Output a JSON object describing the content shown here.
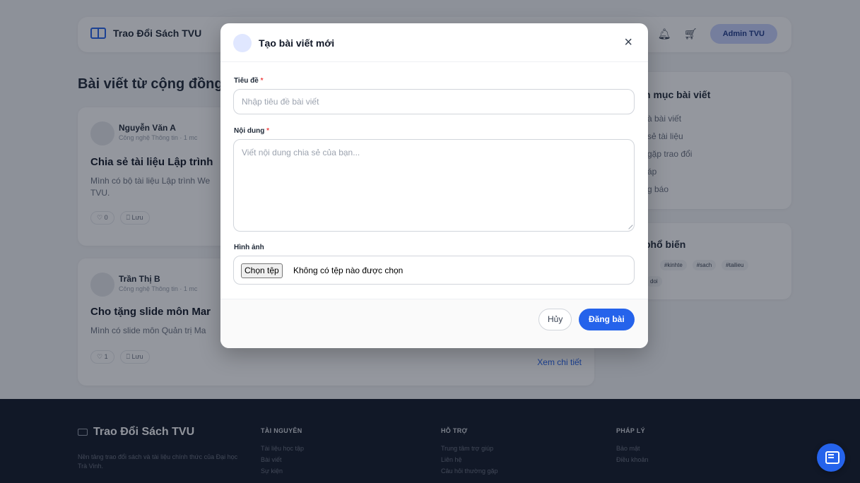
{
  "header": {
    "brand": "Trao Đổi Sách TVU",
    "admin_label": "Admin TVU"
  },
  "feed": {
    "title": "Bài viết từ cộng đồng",
    "posts": [
      {
        "author": "Nguyễn Văn A",
        "meta": "Công nghệ Thông tin · 1 mc",
        "title": "Chia sẻ tài liệu Lập trình",
        "body": "Mình có bộ tài liệu Lập trình We TVU.",
        "likes": "0",
        "save_label": "Lưu"
      },
      {
        "author": "Trần Thị B",
        "meta": "Công nghệ Thông tin · 1 mc",
        "title": "Cho tặng slide môn Mar",
        "body": "Mình có slide môn Quản trị Ma",
        "likes": "1",
        "save_label": "Lưu",
        "detail_link": "Xem chi tiết"
      }
    ]
  },
  "sidebar": {
    "categories_title": "n mục bài viết",
    "categories": [
      "à bài viết",
      "sẻ tài liệu",
      "gặp trao đổi",
      "áp",
      "g báo"
    ],
    "tags_title": "phổ biến",
    "tags": [
      "#kinhte",
      "#sach",
      "#tailieu"
    ],
    "tag_extra": "doi"
  },
  "modal": {
    "title": "Tạo bài viết mới",
    "close_glyph": "×",
    "title_label": "Tiêu đề",
    "title_placeholder": "Nhập tiêu đề bài viết",
    "content_label": "Nội dung",
    "content_placeholder": "Viết nội dung chia sẻ của bạn...",
    "image_label": "Hình ảnh",
    "file_button": "Chọn tệp",
    "file_status": "Không có tệp nào được chọn",
    "required_mark": "*",
    "cancel_label": "Hủy",
    "submit_label": "Đăng bài"
  },
  "footer": {
    "brand": "Trao Đổi Sách TVU",
    "description": "Nền tảng trao đổi sách và tài liệu chính thức của Đại học Trà Vinh.",
    "columns": [
      {
        "heading": "TÀI NGUYÊN",
        "links": [
          "Tài liệu học tập",
          "Bài viết",
          "Sự kiện"
        ]
      },
      {
        "heading": "HỖ TRỢ",
        "links": [
          "Trung tâm trợ giúp",
          "Liên hệ",
          "Câu hỏi thường gặp"
        ]
      },
      {
        "heading": "PHÁP LÝ",
        "links": [
          "Bảo mật",
          "Điều khoản"
        ]
      }
    ]
  },
  "colors": {
    "primary": "#2563eb",
    "footer_bg": "#111827",
    "required": "#ef4444"
  }
}
